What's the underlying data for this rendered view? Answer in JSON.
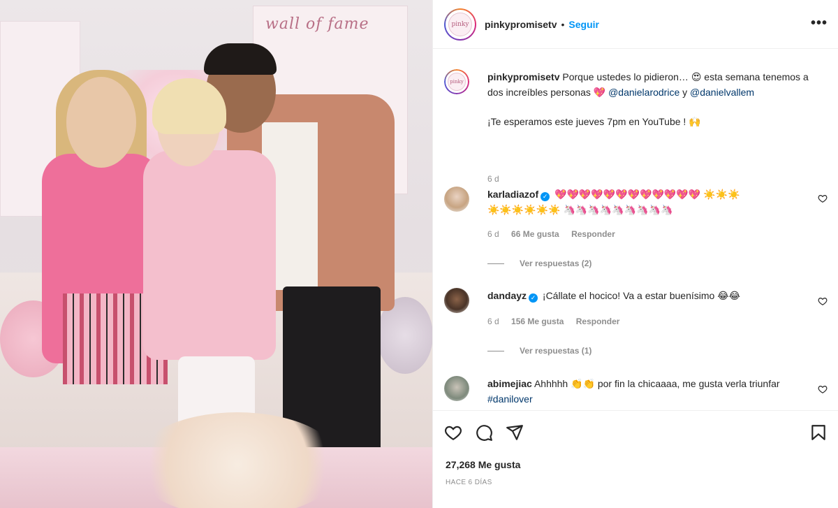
{
  "post": {
    "username": "pinkypromisetv",
    "follow_label": "Seguir",
    "more_label": "•••",
    "logo_text": "pinky",
    "photo_caption_board": "wall of fame"
  },
  "caption": {
    "username": "pinkypromisetv",
    "line1": "Porque ustedes lo pidieron… 😍 esta semana tenemos a dos increíbles personas 💖",
    "mention1": "@danielarodrice",
    "and": "y",
    "mention2": "@danielvallem",
    "line2": "¡Te esperamos este jueves 7pm en YouTube ! 🙌",
    "time": "6 d"
  },
  "comments": [
    {
      "username": "karladiazof",
      "verified": true,
      "text_hearts": "💖💖💖💖💖💖💖💖💖💖💖💖",
      "text_suns_1": "☀️☀️☀️",
      "text_suns_2": "☀️☀️☀️☀️☀️☀️",
      "text_unicorns": "🦄🦄🦄🦄🦄🦄🦄🦄🦄",
      "time": "6 d",
      "likes": "66 Me gusta",
      "reply": "Responder",
      "view_replies": "Ver respuestas (2)"
    },
    {
      "username": "dandayz",
      "verified": true,
      "text": "¡Cállate el hocico! Va a estar buenísimo 😂😂",
      "time": "6 d",
      "likes": "156 Me gusta",
      "reply": "Responder",
      "view_replies": "Ver respuestas (1)"
    },
    {
      "username": "abimejiac",
      "verified": false,
      "text": "Ahhhhh 👏👏 por fin la chicaaaa, me gusta verla triunfar",
      "hashtag": "#danilover"
    }
  ],
  "actions": {
    "likes": "27,268 Me gusta",
    "posted": "HACE 6 DÍAS"
  },
  "colors": {
    "accent": "#0095f6",
    "text": "#262626",
    "muted": "#8e8e8e",
    "mention": "#00376b"
  },
  "icons": [
    "heart-icon",
    "comment-icon",
    "share-icon",
    "bookmark-icon",
    "more-icon",
    "verified-icon"
  ]
}
